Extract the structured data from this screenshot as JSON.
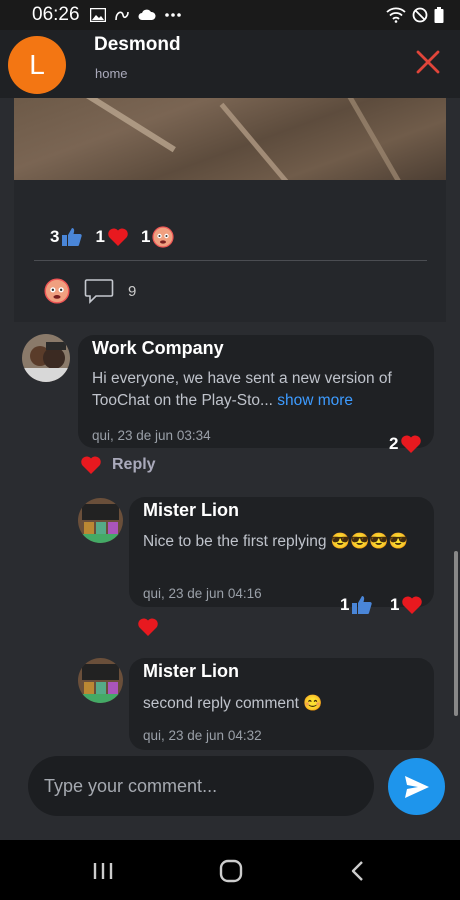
{
  "status_bar": {
    "time": "06:26"
  },
  "header": {
    "avatar_letter": "L",
    "name": "Desmond",
    "subtitle": "home"
  },
  "post": {
    "reactions": [
      {
        "count": "3",
        "icon": "thumbs-up-icon"
      },
      {
        "count": "1",
        "icon": "heart-icon"
      },
      {
        "count": "1",
        "icon": "angry-face-icon"
      }
    ],
    "comment_count": "9"
  },
  "comments": [
    {
      "author": "Work Company",
      "text": "Hi everyone, we have sent a new version of TooChat on the Play-Sto...",
      "show_more": " show more",
      "time": "qui, 23 de jun 03:34",
      "heart_count": "2",
      "reply_label": "Reply"
    },
    {
      "author": "Mister Lion",
      "text": "Nice to be the first replying 😎😎😎😎",
      "time": "qui, 23 de jun 04:16",
      "like_count": "1",
      "heart_count": "1"
    },
    {
      "author": "Mister Lion",
      "text": "second reply comment 😊",
      "time": "qui, 23 de jun 04:32"
    }
  ],
  "composer": {
    "placeholder": "Type your comment..."
  },
  "colors": {
    "accent": "#1e95ec",
    "avatar": "#f37613",
    "heart": "#e8191f",
    "close": "#e0453a",
    "like": "#3a7bd5"
  }
}
